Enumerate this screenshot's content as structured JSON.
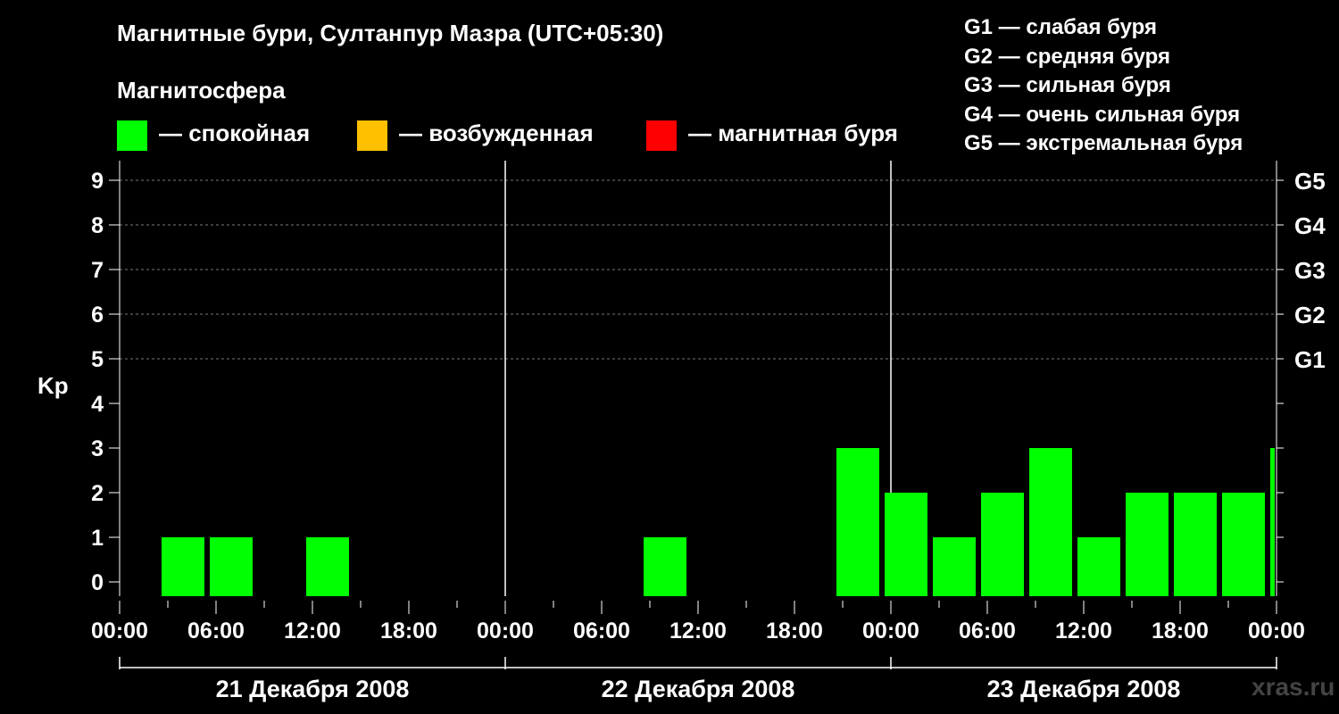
{
  "title": "Магнитные бури, Султанпур Мазра (UTC+05:30)",
  "section_label": "Магнитосфера",
  "legend": [
    {
      "color": "#00ff00",
      "label": "— спокойная"
    },
    {
      "color": "#ffc000",
      "label": "— возбужденная"
    },
    {
      "color": "#ff0000",
      "label": "— магнитная буря"
    }
  ],
  "g_scale": [
    "G1 — слабая буря",
    "G2 — средняя буря",
    "G3 — сильная буря",
    "G4 — очень сильная буря",
    "G5 — экстремальная буря"
  ],
  "watermark": "xras.ru",
  "chart_data": {
    "type": "bar",
    "ylabel": "Kp",
    "ylim": [
      0,
      9
    ],
    "y_ticks": [
      "0",
      "1",
      "2",
      "3",
      "4",
      "5",
      "6",
      "7",
      "8",
      "9"
    ],
    "g_levels": [
      {
        "label": "G1",
        "kp": 5
      },
      {
        "label": "G2",
        "kp": 6
      },
      {
        "label": "G3",
        "kp": 7
      },
      {
        "label": "G4",
        "kp": 8
      },
      {
        "label": "G5",
        "kp": 9
      }
    ],
    "x_ticks": [
      "00:00",
      "06:00",
      "12:00",
      "18:00",
      "00:00",
      "06:00",
      "12:00",
      "18:00",
      "00:00",
      "06:00",
      "12:00",
      "18:00",
      "00:00"
    ],
    "days": [
      "21 Декабря 2008",
      "22 Декабря 2008",
      "23 Декабря 2008"
    ],
    "bar_color": "#00ff00",
    "series": [
      {
        "values": [
          {
            "start": "21 Декабря 2008 02:30",
            "kp": 1
          },
          {
            "start": "21 Декабря 2008 05:30",
            "kp": 1
          },
          {
            "start": "21 Декабря 2008 11:30",
            "kp": 1
          },
          {
            "start": "22 Декабря 2008 08:30",
            "kp": 1
          },
          {
            "start": "22 Декабря 2008 20:30",
            "kp": 3
          },
          {
            "start": "22 Декабря 2008 23:30",
            "kp": 2
          },
          {
            "start": "23 Декабря 2008 02:30",
            "kp": 1
          },
          {
            "start": "23 Декабря 2008 05:30",
            "kp": 2
          },
          {
            "start": "23 Декабря 2008 08:30",
            "kp": 3
          },
          {
            "start": "23 Декабря 2008 11:30",
            "kp": 1
          },
          {
            "start": "23 Декабря 2008 14:30",
            "kp": 2
          },
          {
            "start": "23 Декабря 2008 17:30",
            "kp": 2
          },
          {
            "start": "23 Декабря 2008 20:30",
            "kp": 2
          },
          {
            "start": "23 Декабря 2008 23:30",
            "kp": 3
          }
        ]
      }
    ]
  }
}
